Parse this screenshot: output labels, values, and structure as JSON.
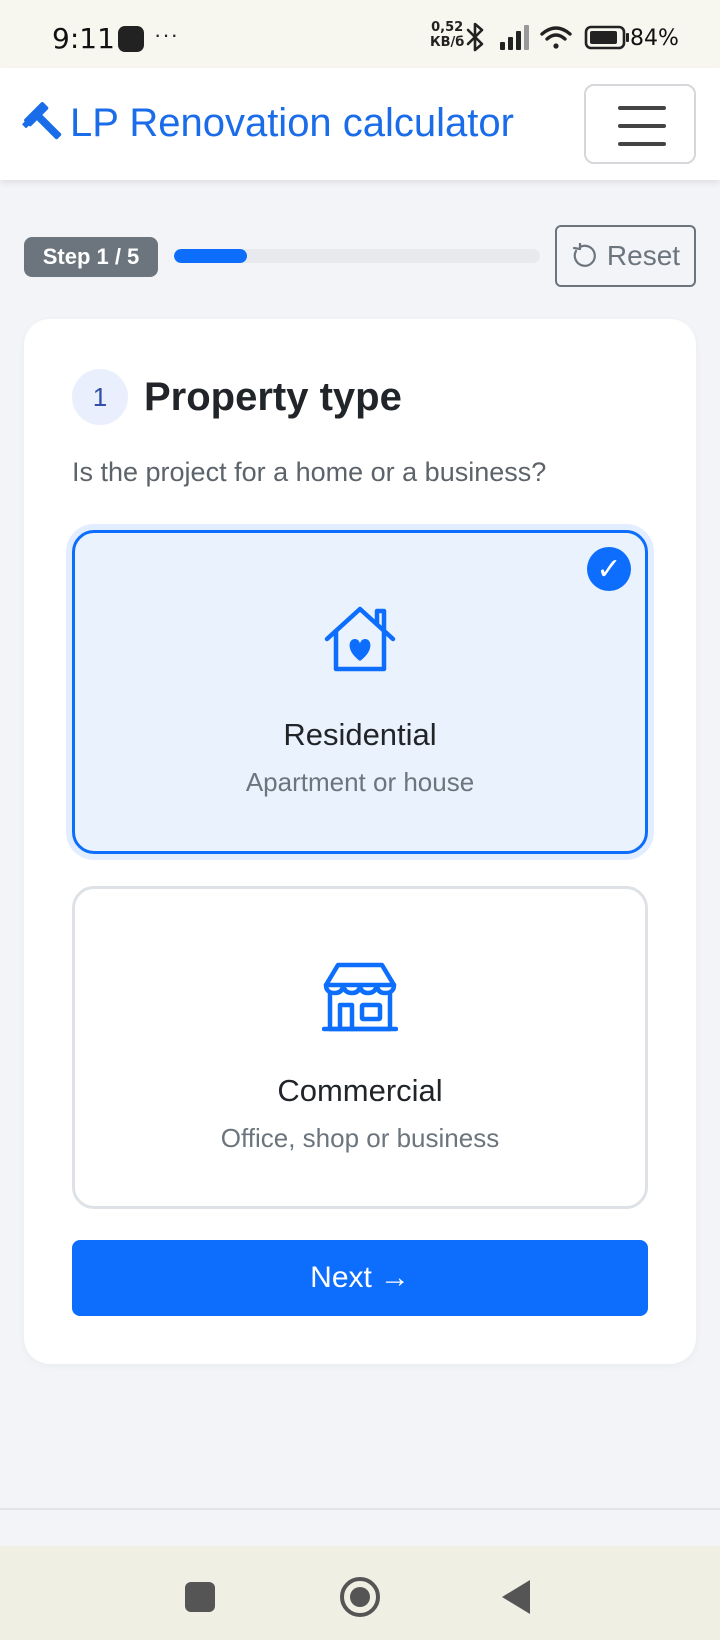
{
  "status_bar": {
    "time": "9:11",
    "more": "···",
    "net_speed_value": "0,52",
    "net_speed_unit": "КВ/б",
    "battery": "84%"
  },
  "navbar": {
    "brand_icon": "hammer-icon",
    "brand_text": "LP Renovation calculator",
    "menu_icon": "hamburger-menu-icon"
  },
  "progress": {
    "step_label": "Step 1 / 5",
    "fraction": 0.2,
    "reset_label": "Reset"
  },
  "step": {
    "number": "1",
    "title": "Property type",
    "question": "Is the project for a home or a business?"
  },
  "options": [
    {
      "icon": "house-heart-icon",
      "title": "Residential",
      "subtitle": "Apartment or house",
      "selected": true
    },
    {
      "icon": "shop-icon",
      "title": "Commercial",
      "subtitle": "Office, shop or business",
      "selected": false
    }
  ],
  "check_mark": "✓",
  "next": {
    "label": "Next",
    "arrow": "→"
  },
  "colors": {
    "primary": "#0d6efd",
    "brand": "#1a6ce8",
    "secondary": "#6c757d",
    "selected_bg": "#eaf2fd"
  }
}
